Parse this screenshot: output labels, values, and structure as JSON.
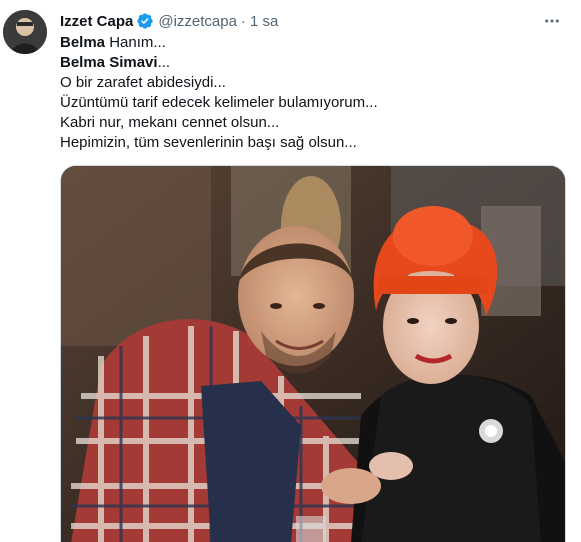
{
  "author": {
    "display_name": "Izzet Capa",
    "handle": "@izzetcapa",
    "separator": "·",
    "time": "1 sa",
    "verified_icon": "verified-badge-icon",
    "avatar_icon": "avatar-photo"
  },
  "tweet": {
    "lines": [
      {
        "bold": "Belma",
        "rest": " Hanım..."
      },
      {
        "bold": "Belma Simavi",
        "rest": "..."
      },
      {
        "bold": "",
        "rest": "O bir zarafet abidesiydi..."
      },
      {
        "bold": "",
        "rest": "Üzüntümü tarif edecek kelimeler bulamıyorum..."
      },
      {
        "bold": "",
        "rest": "Kabri nur, mekanı cennet olsun..."
      },
      {
        "bold": "",
        "rest": "Hepimizin, tüm sevenlerinin başı sağ olsun..."
      }
    ]
  },
  "media": {
    "description_icon": "tweet-photo"
  },
  "colors": {
    "text": "#0f1419",
    "secondary": "#536471",
    "verified": "#1d9bf0",
    "border": "#cfd9de"
  }
}
